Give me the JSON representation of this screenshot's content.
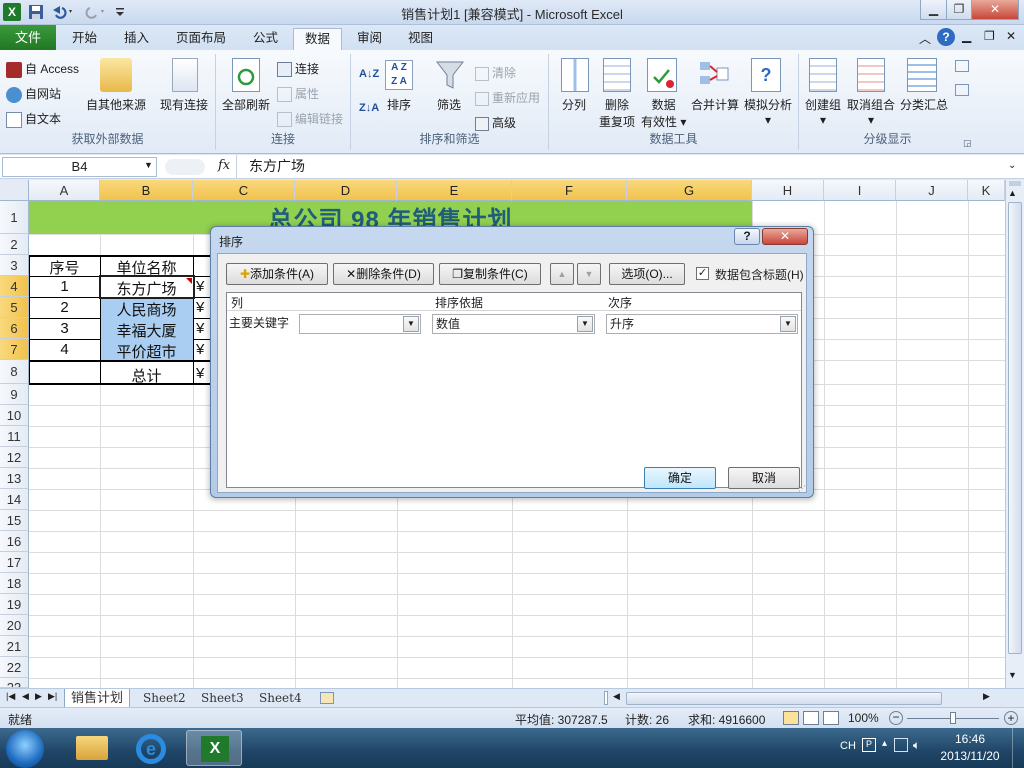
{
  "window": {
    "title": "销售计划1  [兼容模式] - Microsoft Excel"
  },
  "tabs": [
    "文件",
    "开始",
    "插入",
    "页面布局",
    "公式",
    "数据",
    "审阅",
    "视图"
  ],
  "ribbon": {
    "get_external": {
      "access": "自 Access",
      "web": "自网站",
      "text": "自文本",
      "other": "自其他来源",
      "existing": "现有连接",
      "label": "获取外部数据"
    },
    "connections": {
      "refresh_all": "全部刷新",
      "connections": "连接",
      "properties": "属性",
      "edit_links": "编辑链接",
      "label": "连接"
    },
    "sort_filter": {
      "sort": "排序",
      "filter": "筛选",
      "clear": "清除",
      "reapply": "重新应用",
      "advanced": "高级",
      "label": "排序和筛选"
    },
    "data_tools": {
      "split": "分列",
      "dedupe_1": "删除",
      "dedupe_2": "重复项",
      "validation_1": "数据",
      "validation_2": "有效性",
      "consolidate": "合并计算",
      "whatif": "模拟分析",
      "label": "数据工具"
    },
    "outline": {
      "group": "创建组",
      "ungroup": "取消组合",
      "subtotal": "分类汇总",
      "label": "分级显示"
    }
  },
  "formula_bar": {
    "name_box": "B4",
    "fx": "fx",
    "value": "东方广场"
  },
  "columns": [
    "A",
    "B",
    "C",
    "D",
    "E",
    "F",
    "G",
    "H",
    "I",
    "J",
    "K"
  ],
  "rows": [
    "1",
    "2",
    "3",
    "4",
    "5",
    "6",
    "7",
    "8",
    "9",
    "10",
    "11",
    "12",
    "13",
    "14",
    "15",
    "16",
    "17",
    "18",
    "19",
    "20",
    "21",
    "22",
    "23"
  ],
  "sheet": {
    "title": "总公司 98 年销售计划",
    "header": {
      "no": "序号",
      "name": "单位名称"
    },
    "rows": [
      {
        "no": "1",
        "name": "东方广场",
        "c": "¥"
      },
      {
        "no": "2",
        "name": "人民商场",
        "c": "¥"
      },
      {
        "no": "3",
        "name": "幸福大厦",
        "c": "¥"
      },
      {
        "no": "4",
        "name": "平价超市",
        "c": "¥"
      }
    ],
    "total": {
      "label": "总计",
      "c": "¥"
    }
  },
  "dialog": {
    "title": "排序",
    "help": "?",
    "add": "添加条件(A)",
    "delete": "删除条件(D)",
    "copy": "复制条件(C)",
    "up": "▲",
    "down": "▼",
    "options": "选项(O)...",
    "has_header": "数据包含标题(H)",
    "col_header": "列",
    "basis_header": "排序依据",
    "order_header": "次序",
    "row_label": "主要关键字",
    "key_value": "",
    "basis_value": "数值",
    "order_value": "升序",
    "ok": "确定",
    "cancel": "取消"
  },
  "sheet_tabs": [
    "销售计划",
    "Sheet2",
    "Sheet3",
    "Sheet4"
  ],
  "status": {
    "mode": "就绪",
    "average": "平均值: 307287.5",
    "count": "计数: 26",
    "sum": "求和: 4916600",
    "zoom": "100%"
  },
  "taskbar": {
    "lang": "CH",
    "time": "16:46",
    "date": "2013/11/20"
  }
}
